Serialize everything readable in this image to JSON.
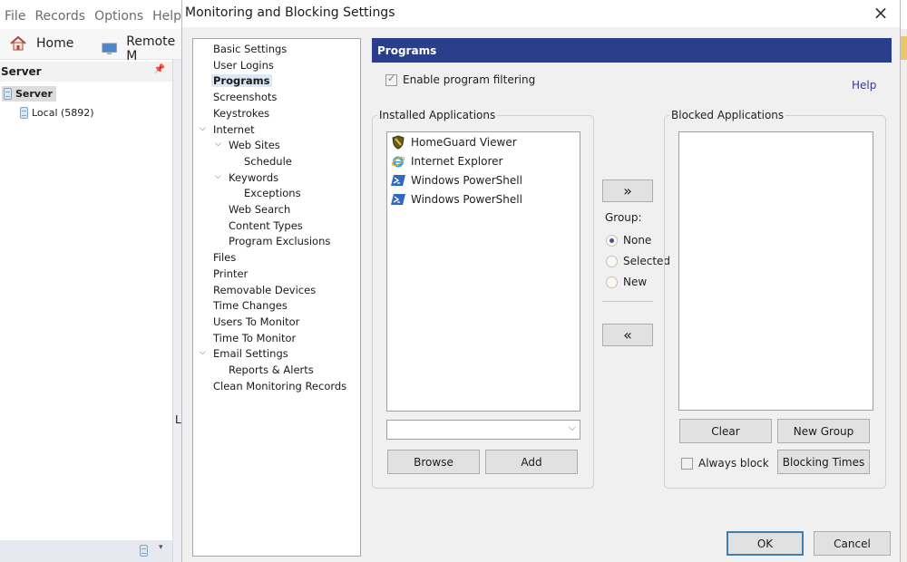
{
  "app": {
    "menu": [
      "File",
      "Records",
      "Options",
      "Help"
    ],
    "toolbar": {
      "home_label": "Home",
      "remote_label": "Remote M"
    },
    "panel_title": "Server",
    "tree": {
      "root": "Server",
      "child": "Local (5892)"
    },
    "partial_letter": "L"
  },
  "dialog": {
    "title": "Monitoring and Blocking Settings",
    "close_icon": "×",
    "nav": [
      {
        "label": "Basic Settings",
        "level": 0
      },
      {
        "label": "User Logins",
        "level": 0
      },
      {
        "label": "Programs",
        "level": 0,
        "active": true
      },
      {
        "label": "Screenshots",
        "level": 0
      },
      {
        "label": "Keystrokes",
        "level": 0
      },
      {
        "label": "Internet",
        "level": 0,
        "expanded": true
      },
      {
        "label": "Web Sites",
        "level": 1,
        "expanded": true
      },
      {
        "label": "Schedule",
        "level": 2
      },
      {
        "label": "Keywords",
        "level": 1,
        "expanded": true
      },
      {
        "label": "Exceptions",
        "level": 2
      },
      {
        "label": "Web Search",
        "level": 1
      },
      {
        "label": "Content Types",
        "level": 1
      },
      {
        "label": "Program Exclusions",
        "level": 1
      },
      {
        "label": "Files",
        "level": 0
      },
      {
        "label": "Printer",
        "level": 0
      },
      {
        "label": "Removable Devices",
        "level": 0
      },
      {
        "label": "Time Changes",
        "level": 0
      },
      {
        "label": "Users To Monitor",
        "level": 0
      },
      {
        "label": "Time To Monitor",
        "level": 0
      },
      {
        "label": "Email Settings",
        "level": 0,
        "expanded": true
      },
      {
        "label": "Reports & Alerts",
        "level": 1
      },
      {
        "label": "Clean Monitoring Records",
        "level": 0
      }
    ],
    "section_title": "Programs",
    "enable_filtering": {
      "label": "Enable program filtering",
      "checked": true
    },
    "help_label": "Help",
    "installed": {
      "label": "Installed Applications",
      "apps": [
        {
          "name": "HomeGuard Viewer",
          "icon": "shield-icon"
        },
        {
          "name": "Internet Explorer",
          "icon": "internet-explorer-icon"
        },
        {
          "name": "Windows PowerShell",
          "icon": "powershell-icon"
        },
        {
          "name": "Windows PowerShell",
          "icon": "powershell-icon"
        }
      ],
      "combo_value": "",
      "browse_label": "Browse",
      "add_label": "Add"
    },
    "move_right_label": "»",
    "move_left_label": "«",
    "group": {
      "label": "Group:",
      "options": [
        "None",
        "Selected",
        "New"
      ],
      "selected": "None"
    },
    "blocked": {
      "label": "Blocked Applications",
      "apps": [],
      "clear_label": "Clear",
      "new_group_label": "New Group",
      "always_block_label": "Always block",
      "always_block_checked": false,
      "blocking_times_label": "Blocking Times"
    },
    "ok_label": "OK",
    "cancel_label": "Cancel"
  },
  "colors": {
    "section_bar": "#2b3e8c",
    "help_link": "#2f3a9c",
    "default_button_border": "#3c7fb1"
  }
}
